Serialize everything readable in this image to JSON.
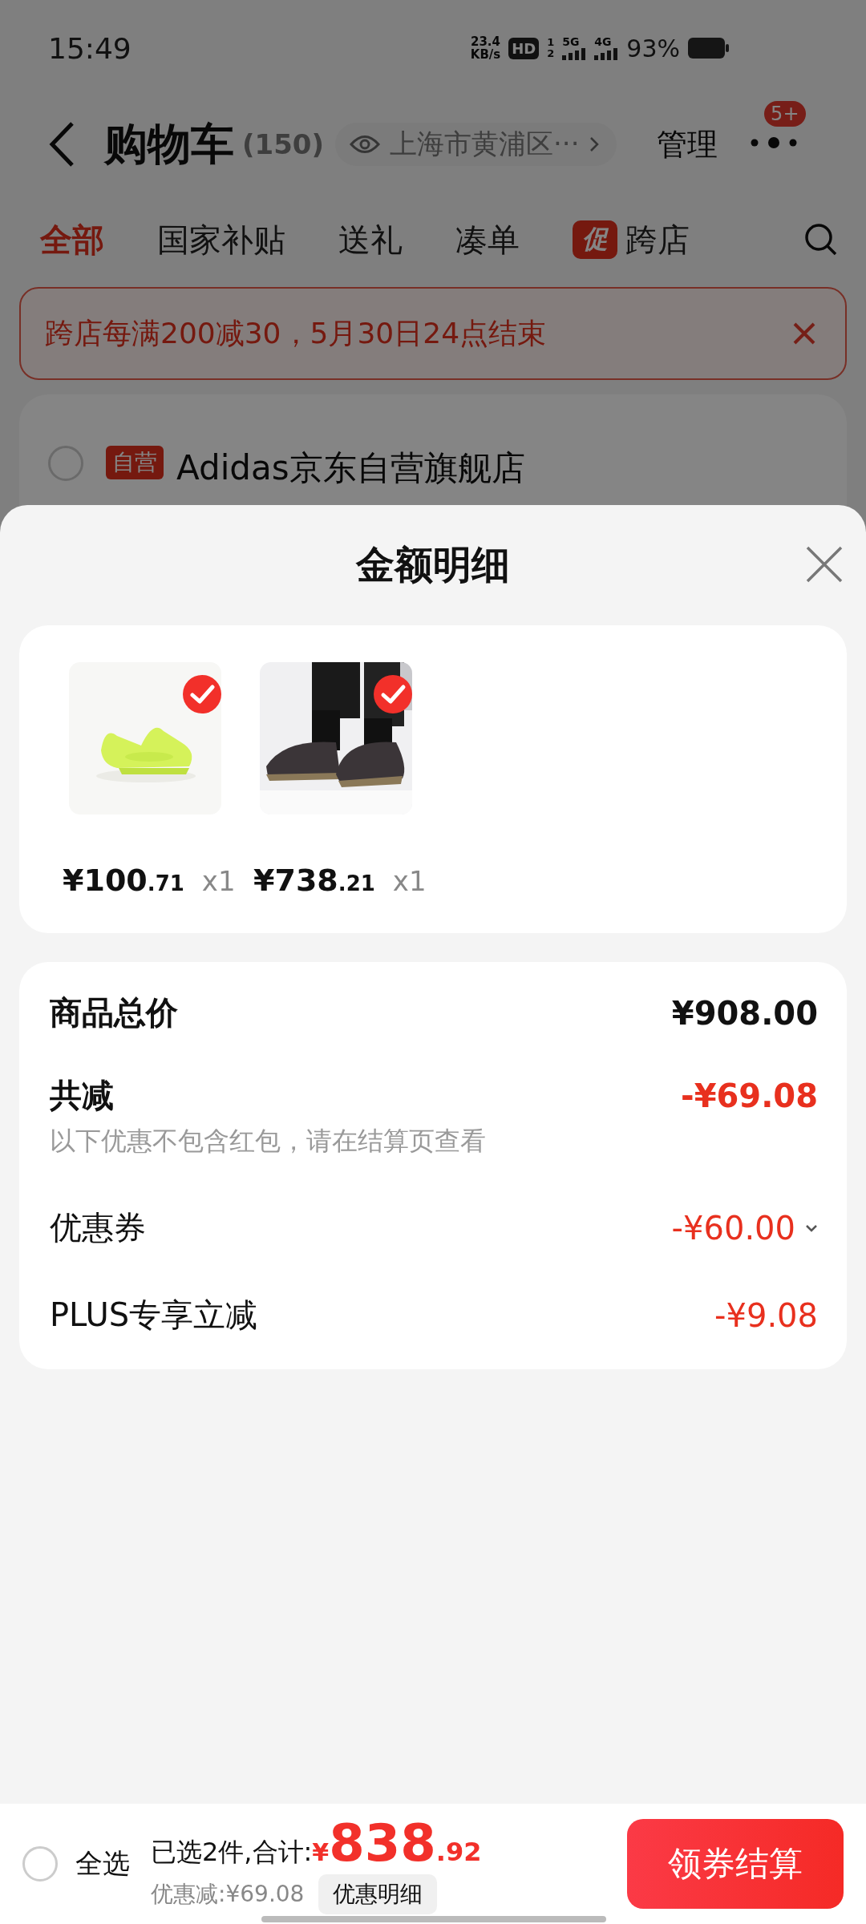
{
  "status_bar": {
    "time": "15:49",
    "speed": "23.4",
    "speed_unit": "KB/s",
    "hd": "HD",
    "sim_slots": [
      "1",
      "2"
    ],
    "networks": [
      "5G",
      "4G"
    ],
    "battery": "93%"
  },
  "header": {
    "title": "购物车",
    "count": "(150)",
    "location": "上海市黄浦区···",
    "manage": "管理",
    "badge": "5+"
  },
  "tabs": [
    {
      "label": "全部",
      "selected": true
    },
    {
      "label": "国家补贴",
      "selected": false
    },
    {
      "label": "送礼",
      "selected": false
    },
    {
      "label": "凑单",
      "selected": false
    },
    {
      "label": "跨店",
      "selected": false,
      "tag": "促"
    }
  ],
  "banner": {
    "text": "跨店每满200减30，5月30日24点结束"
  },
  "store": {
    "tag": "自营",
    "name": "Adidas京东自营旗舰店",
    "checked": false
  },
  "sheet": {
    "title": "金额明细",
    "items": [
      {
        "kind": "picture",
        "checked": true,
        "price": "¥100.71",
        "qty": "x1"
      },
      {
        "kind": "picture",
        "checked": true,
        "price": "¥738.21",
        "qty": "x1"
      }
    ],
    "summary": [
      {
        "kind": "total",
        "label": "商品总价",
        "value": "¥908.00"
      },
      {
        "kind": "discount",
        "label": "共减",
        "value": "-¥69.08",
        "note": "以下优惠不包含红包，请在结算页查看"
      },
      {
        "kind": "line",
        "label": "优惠券",
        "value": "-¥60.00",
        "expanded": false
      },
      {
        "kind": "line",
        "label": "PLUS专享立减",
        "value": "-¥9.08"
      }
    ]
  },
  "footer": {
    "select_all": {
      "label": "全选",
      "checked": false
    },
    "selected_text": "已选2件,合计:",
    "total": "¥838.92",
    "saved": "优惠减:¥69.08",
    "details": "优惠明细",
    "checkout": "领券结算"
  }
}
